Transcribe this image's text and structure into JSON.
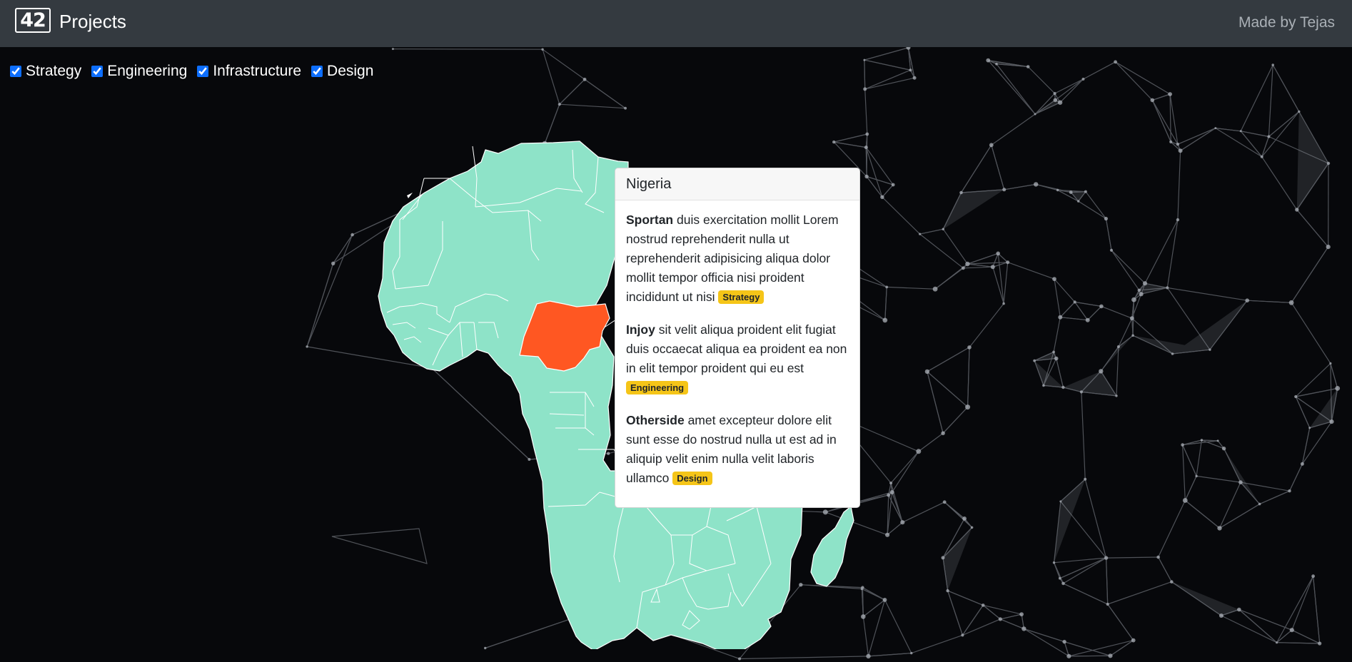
{
  "header": {
    "brand_number": "42",
    "brand_title": "Projects",
    "credit": "Made by Tejas"
  },
  "filters": [
    {
      "label": "Strategy",
      "checked": true
    },
    {
      "label": "Engineering",
      "checked": true
    },
    {
      "label": "Infrastructure",
      "checked": true
    },
    {
      "label": "Design",
      "checked": true
    }
  ],
  "map": {
    "region": "Africa",
    "land_color": "#8ee3c8",
    "highlight_color": "#ff5722",
    "highlighted_country": "Nigeria"
  },
  "popover": {
    "title": "Nigeria",
    "projects": [
      {
        "name": "Sportan",
        "description": "duis exercitation mollit Lorem nostrud reprehenderit nulla ut reprehenderit adipisicing aliqua dolor mollit tempor officia nisi proident incididunt ut nisi",
        "tag": "Strategy"
      },
      {
        "name": "Injoy",
        "description": "sit velit aliqua proident elit fugiat duis occaecat aliqua ea proident ea non in elit tempor proident qui eu est",
        "tag": "Engineering"
      },
      {
        "name": "Otherside",
        "description": "amet excepteur dolore elit sunt esse do nostrud nulla ut est ad in aliquip velit enim nulla velit laboris ullamco",
        "tag": "Design"
      }
    ]
  },
  "colors": {
    "navbar": "#343a40",
    "background": "#07080b",
    "badge": "#f5c518"
  }
}
